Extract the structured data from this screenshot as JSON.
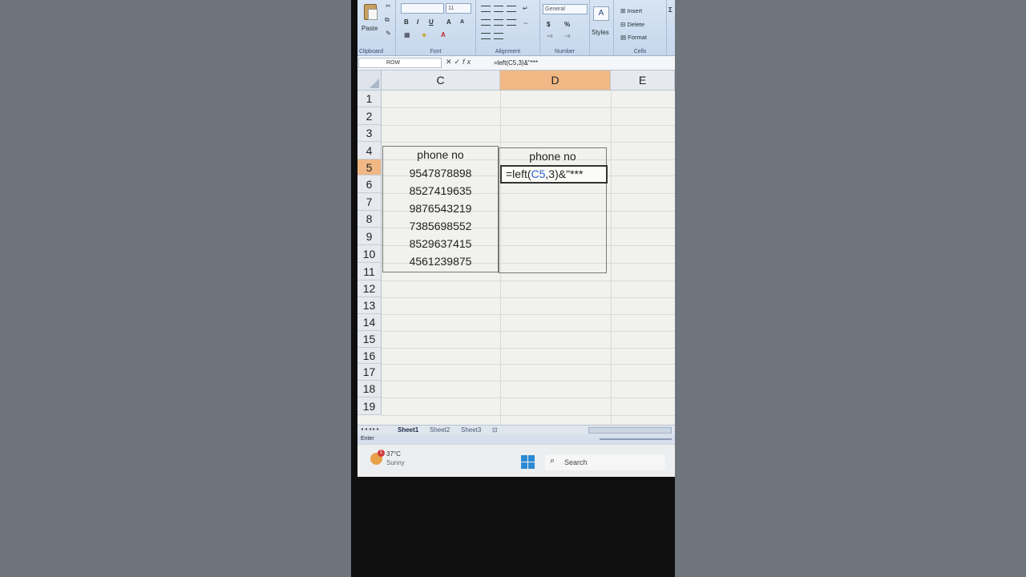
{
  "ribbon": {
    "clipboard": {
      "paste": "Paste",
      "label": "Clipboard"
    },
    "font": {
      "size": "11",
      "bold": "B",
      "italic": "I",
      "underline": "U",
      "grow": "A",
      "shrink": "A",
      "label": "Font"
    },
    "alignment": {
      "label": "Alignment"
    },
    "number": {
      "format": "General",
      "currency": "$",
      "percent": "%",
      "label": "Number"
    },
    "styles": {
      "label": "Styles"
    },
    "cells": {
      "insert": "Insert",
      "delete": "Delete",
      "format": "Format",
      "label": "Cells"
    }
  },
  "formula_bar": {
    "name_box": "ROW",
    "fx": "fx",
    "formula": "=left(C5,3)&\"***"
  },
  "grid": {
    "columns": [
      "C",
      "D",
      "E"
    ],
    "rows": [
      "1",
      "2",
      "3",
      "4",
      "5",
      "6",
      "7",
      "8",
      "9",
      "10",
      "11",
      "12",
      "13",
      "14",
      "15",
      "16",
      "17",
      "18",
      "19"
    ],
    "header_c": "phone no",
    "header_d": "phone no",
    "phones": [
      "9547878898",
      "8527419635",
      "9876543219",
      "7385698552",
      "8529637415",
      "4561239875"
    ],
    "d5_formula": {
      "prefix": "=left(",
      "ref": "C5",
      "suffix": ",3)&\"***"
    }
  },
  "sheets": [
    "Sheet1",
    "Sheet2",
    "Sheet3"
  ],
  "status": {
    "mode": "Enter"
  },
  "taskbar": {
    "badge": "1",
    "temperature": "37°C",
    "condition": "Sunny",
    "search": "Search"
  }
}
